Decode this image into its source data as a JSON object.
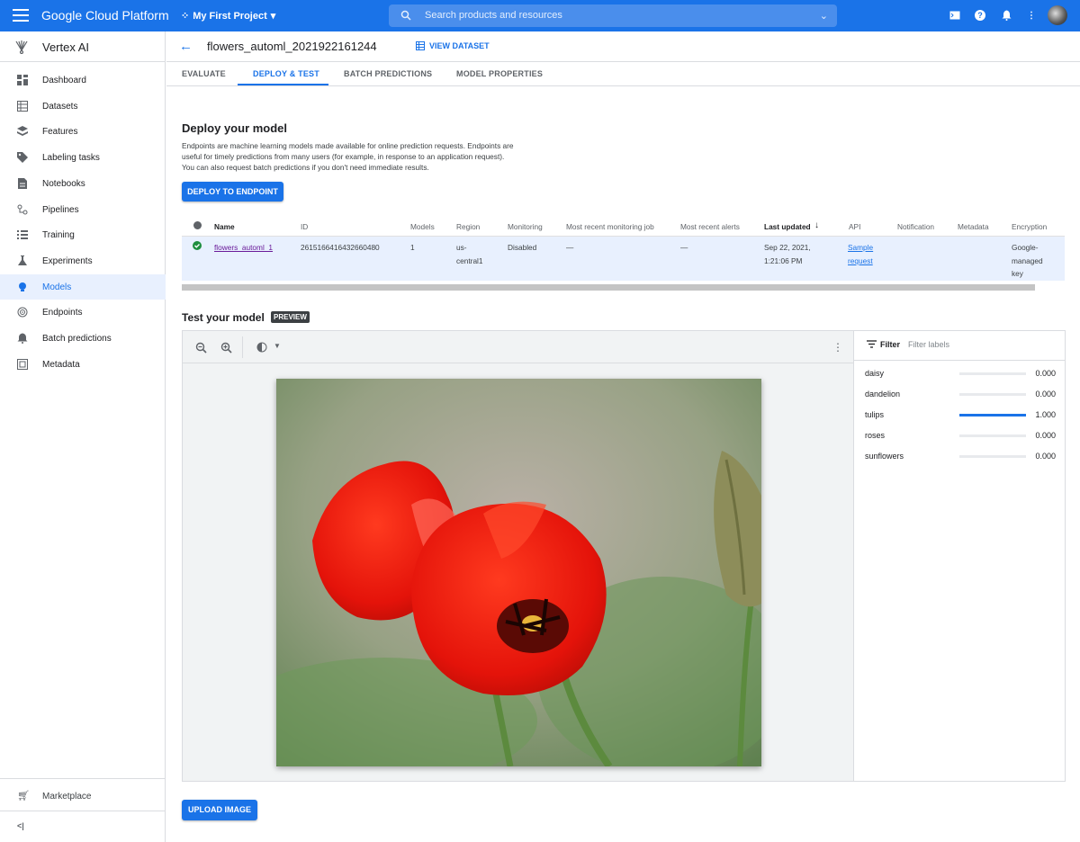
{
  "topbar": {
    "brand": "Google Cloud Platform",
    "project": "My First Project",
    "search_placeholder": "Search products and resources"
  },
  "sidebar": {
    "product": "Vertex AI",
    "items": [
      {
        "label": "Dashboard",
        "icon": "dashboard-icon"
      },
      {
        "label": "Datasets",
        "icon": "datasets-icon"
      },
      {
        "label": "Features",
        "icon": "features-icon"
      },
      {
        "label": "Labeling tasks",
        "icon": "label-icon"
      },
      {
        "label": "Notebooks",
        "icon": "notebook-icon"
      },
      {
        "label": "Pipelines",
        "icon": "pipelines-icon"
      },
      {
        "label": "Training",
        "icon": "training-icon"
      },
      {
        "label": "Experiments",
        "icon": "experiments-icon"
      },
      {
        "label": "Models",
        "icon": "models-icon",
        "active": true
      },
      {
        "label": "Endpoints",
        "icon": "endpoints-icon"
      },
      {
        "label": "Batch predictions",
        "icon": "bell-icon"
      },
      {
        "label": "Metadata",
        "icon": "metadata-icon"
      }
    ],
    "marketplace": "Marketplace",
    "collapse": "<|"
  },
  "header": {
    "title": "flowers_automl_2021922161244",
    "view_dataset": "VIEW DATASET"
  },
  "tabs": [
    "EVALUATE",
    "DEPLOY & TEST",
    "BATCH PREDICTIONS",
    "MODEL PROPERTIES"
  ],
  "deploy": {
    "heading": "Deploy your model",
    "description": "Endpoints are machine learning models made available for online prediction requests. Endpoints are useful for timely predictions from many users (for example, in response to an application request). You can also request batch predictions if you don't need immediate results.",
    "button": "DEPLOY TO ENDPOINT"
  },
  "table": {
    "columns": [
      "Name",
      "ID",
      "Models",
      "Region",
      "Monitoring",
      "Most recent monitoring job",
      "Most recent alerts",
      "Last updated",
      "API",
      "Notification",
      "Metadata",
      "Encryption"
    ],
    "row": {
      "name": "flowers_automl_1",
      "id": "2615166416432660480",
      "models": "1",
      "region_1": "us-",
      "region_2": "central1",
      "monitoring": "Disabled",
      "job": "—",
      "alerts": "—",
      "updated_1": "Sep 22, 2021,",
      "updated_2": "1:21:06 PM",
      "api_1": "Sample",
      "api_2": "request",
      "notification": "",
      "metadata": "",
      "enc_1": "Google-",
      "enc_2": "managed",
      "enc_3": "key"
    }
  },
  "test": {
    "heading": "Test your model",
    "badge": "PREVIEW",
    "upload": "UPLOAD IMAGE"
  },
  "filter": {
    "label": "Filter",
    "placeholder": "Filter labels"
  },
  "predictions": [
    {
      "label": "daisy",
      "score": "0.000",
      "value": 0.0
    },
    {
      "label": "dandelion",
      "score": "0.000",
      "value": 0.0
    },
    {
      "label": "tulips",
      "score": "1.000",
      "value": 1.0
    },
    {
      "label": "roses",
      "score": "0.000",
      "value": 0.0
    },
    {
      "label": "sunflowers",
      "score": "0.000",
      "value": 0.0
    }
  ]
}
